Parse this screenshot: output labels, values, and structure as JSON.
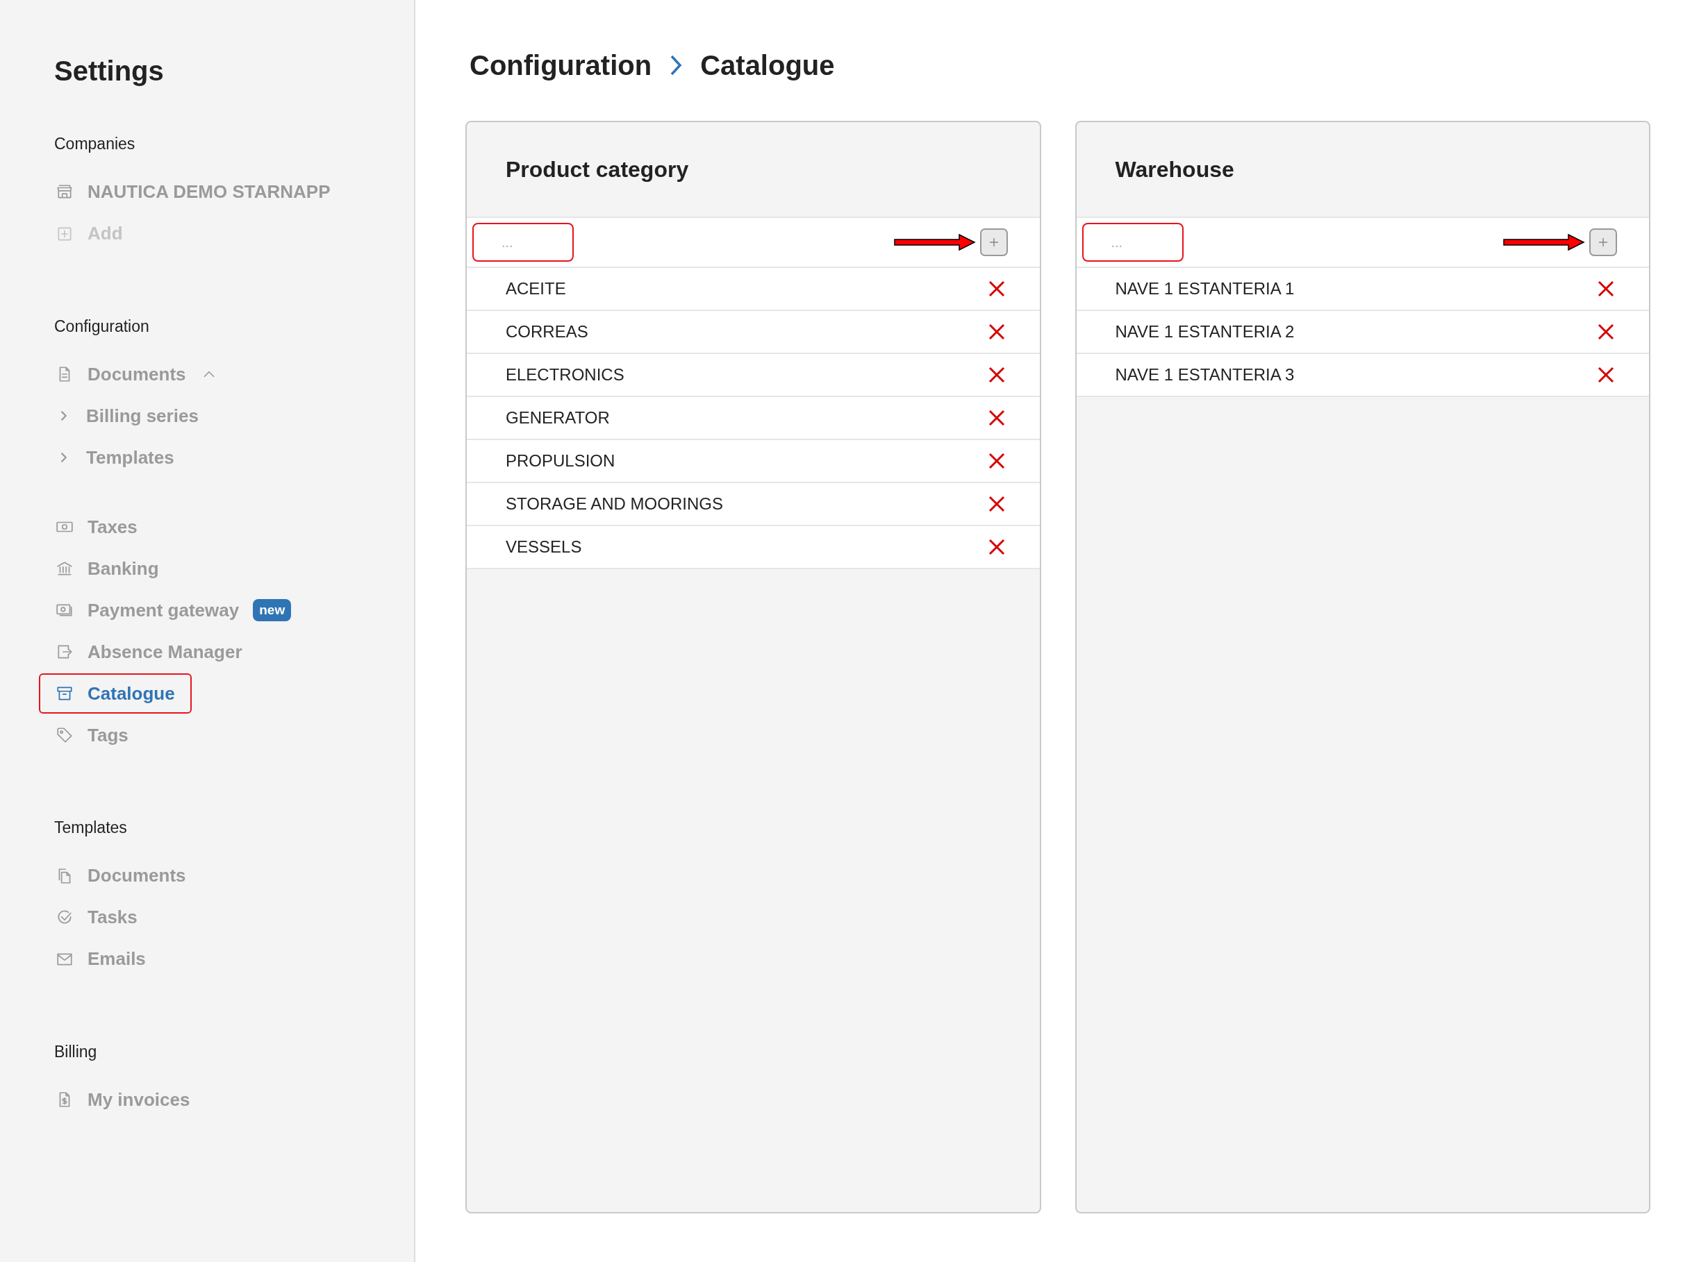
{
  "sidebar": {
    "title": "Settings",
    "sections": [
      {
        "heading": "Companies",
        "items": [
          {
            "label": "NAUTICA DEMO STARNAPP",
            "kind": "link",
            "selected": false,
            "annotated": false
          },
          {
            "label": "Add",
            "kind": "add",
            "selected": false,
            "annotated": false
          }
        ]
      },
      {
        "heading": "Configuration",
        "items": [
          {
            "label": "Documents",
            "kind": "group",
            "selected": false,
            "annotated": false,
            "expanded": true,
            "children": [
              {
                "label": "Billing series",
                "selected": false
              },
              {
                "label": "Templates",
                "selected": false
              }
            ]
          },
          {
            "label": "Taxes",
            "kind": "link",
            "selected": false,
            "annotated": false
          },
          {
            "label": "Banking",
            "kind": "link",
            "selected": false,
            "annotated": false
          },
          {
            "label": "Payment gateway",
            "kind": "link",
            "selected": false,
            "annotated": false,
            "badge": "new"
          },
          {
            "label": "Absence Manager",
            "kind": "link",
            "selected": false,
            "annotated": false
          },
          {
            "label": "Catalogue",
            "kind": "link",
            "selected": true,
            "annotated": true
          },
          {
            "label": "Tags",
            "kind": "link",
            "selected": false,
            "annotated": false
          }
        ]
      },
      {
        "heading": "Templates",
        "items": [
          {
            "label": "Documents",
            "kind": "link",
            "selected": false,
            "annotated": false
          },
          {
            "label": "Tasks",
            "kind": "link",
            "selected": false,
            "annotated": false
          },
          {
            "label": "Emails",
            "kind": "link",
            "selected": false,
            "annotated": false
          }
        ]
      },
      {
        "heading": "Billing",
        "items": [
          {
            "label": "My invoices",
            "kind": "link",
            "selected": false,
            "annotated": false
          }
        ]
      }
    ]
  },
  "breadcrumb": [
    "Configuration",
    "Catalogue"
  ],
  "panels": [
    {
      "title": "Product category",
      "field": {
        "placeholder": "...",
        "annotated": true
      },
      "items": [
        "ACEITE",
        "CORREAS",
        "ELECTRONICS",
        "GENERATOR",
        "PROPULSION",
        "STORAGE AND MOORINGS",
        "VESSELS"
      ]
    },
    {
      "title": "Warehouse",
      "field": {
        "placeholder": "...",
        "annotated": true
      },
      "items": [
        "NAVE 1 ESTANTERIA 1",
        "NAVE 1 ESTANTERIA 2",
        "NAVE 1 ESTANTERIA 3"
      ]
    }
  ]
}
